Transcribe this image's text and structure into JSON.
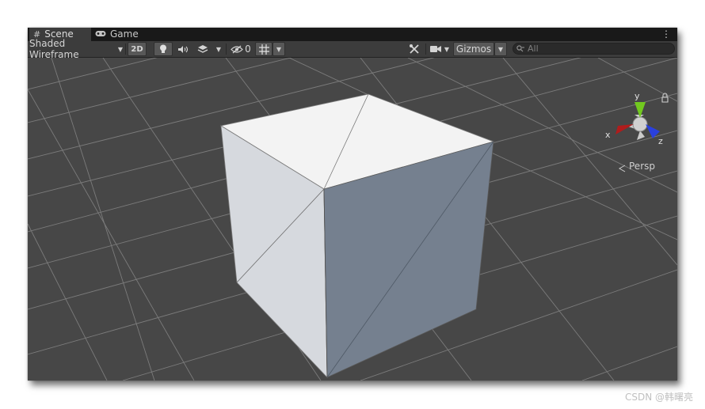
{
  "tabs": [
    {
      "icon": "scene-grid-icon",
      "glyph": "#",
      "label": "Scene",
      "active": true
    },
    {
      "icon": "game-controller-icon",
      "glyph": "⚯",
      "label": "Game",
      "active": false
    }
  ],
  "toolbar": {
    "shading_mode": "Shaded Wireframe",
    "mode_2d": "2D",
    "hidden_count": "0",
    "gizmos_label": "Gizmos",
    "search_placeholder": "All"
  },
  "orientation_gizmo": {
    "y_label": "y",
    "x_label": "x",
    "z_label": "z",
    "projection_label": "Persp"
  },
  "watermark": "CSDN @韩曙亮",
  "colors": {
    "background": "#474747",
    "toolbar": "#3c3c3c",
    "tabbar": "#191919",
    "grid_line": "#8a8a8a",
    "cube_top": "#f3f3f3",
    "cube_left": "#d6d9de",
    "cube_right": "#75808f",
    "axis_x": "#b01c1c",
    "axis_y": "#72c91f",
    "axis_z": "#2a40dd"
  }
}
